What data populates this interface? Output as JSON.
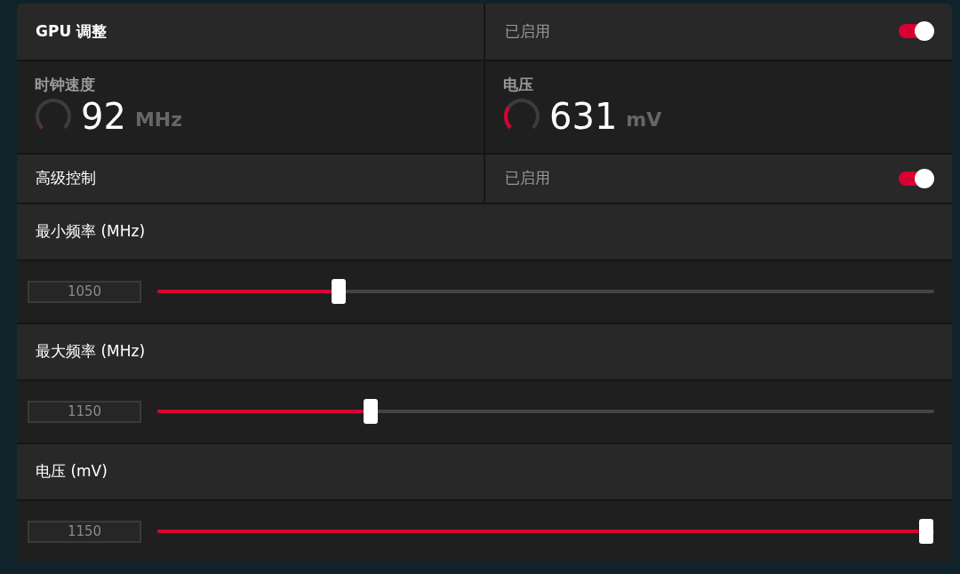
{
  "header": {
    "title": "GPU 调整",
    "status": "已启用",
    "on": true
  },
  "gauges": [
    {
      "label": "时钟速度",
      "value": "92",
      "unit": "MHz"
    },
    {
      "label": "电压",
      "value": "631",
      "unit": "mV"
    }
  ],
  "advanced": {
    "title": "高级控制",
    "status": "已启用",
    "on": true
  },
  "sliders": [
    {
      "label": "最小频率 (MHz)",
      "value": "1050",
      "level": 0.233
    },
    {
      "label": "最大频率 (MHz)",
      "value": "1150",
      "level": 0.275
    },
    {
      "label": "电压 (mV)",
      "value": "1150",
      "level": 0.99
    }
  ]
}
